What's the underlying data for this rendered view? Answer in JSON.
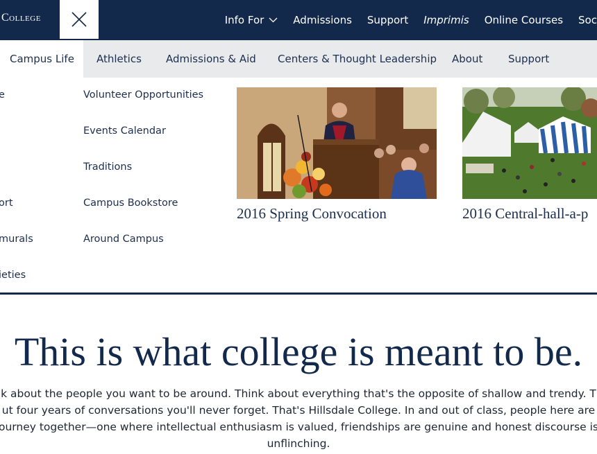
{
  "header": {
    "logo_text": "College",
    "close_icon": "close-icon",
    "nav": [
      {
        "label": "Info For"
      },
      {
        "label": "Admissions"
      },
      {
        "label": "Support"
      },
      {
        "label": "Imprimis"
      },
      {
        "label": "Online Courses"
      },
      {
        "label": "Soc"
      }
    ]
  },
  "subnav": [
    {
      "label": "Campus Life"
    },
    {
      "label": "Athletics"
    },
    {
      "label": "Admissions & Aid"
    },
    {
      "label": "Centers & Thought Leadership"
    },
    {
      "label": "About"
    },
    {
      "label": "Support"
    }
  ],
  "menu": {
    "col1": [
      "e",
      "",
      "",
      "ort",
      "murals",
      "ieties"
    ],
    "col2": [
      "Volunteer Opportunities",
      "Events Calendar",
      "Traditions",
      "Campus Bookstore",
      "Around Campus"
    ]
  },
  "features": [
    {
      "caption": "2016 Spring Convocation"
    },
    {
      "caption": "2016 Central-hall-a-p"
    }
  ],
  "hero": {
    "title": "This is what college is meant to be.",
    "lines": [
      "k about the people you want to be around. Think about everything that's the opposite of shallow and trendy. T",
      "ut four years of conversations you'll never forget. That's Hillsdale College. In and out of class, people here are",
      "ourney together—one where intellectual enthusiasm is valued, friendships are genuine and honest discourse is",
      "unflinching."
    ]
  },
  "colors": {
    "navy": "#13294b",
    "subnav_bg": "#e9eaec",
    "text": "#1c2e4f"
  }
}
